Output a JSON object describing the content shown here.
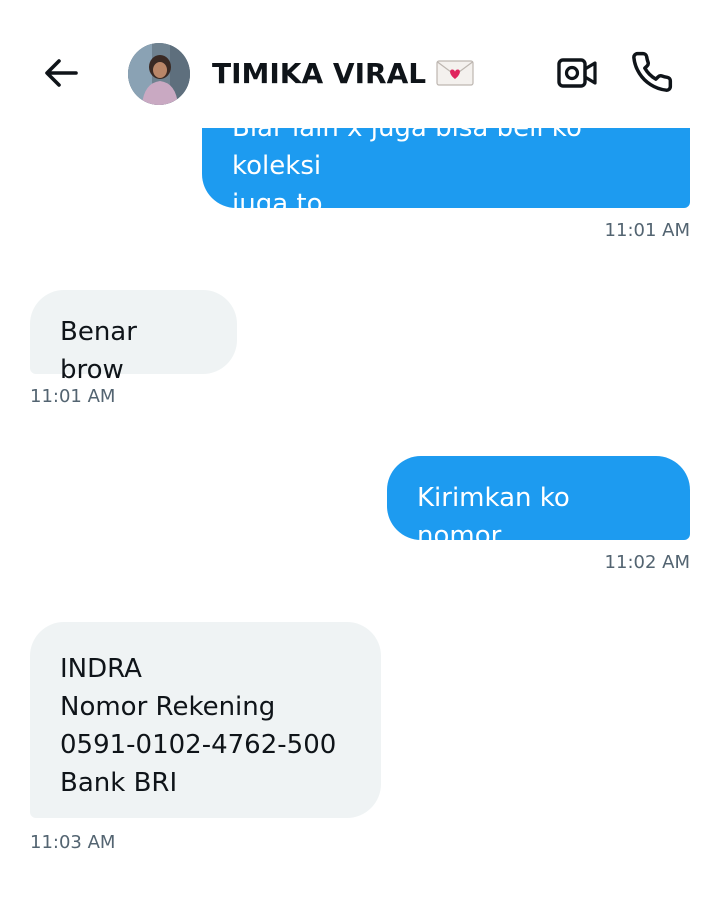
{
  "header": {
    "contact_name": "TIMIKA VIRAL",
    "badge_icon": "love-letter-icon",
    "back_icon": "arrow-left-icon",
    "video_icon": "video-camera-icon",
    "call_icon": "phone-icon"
  },
  "colors": {
    "outgoing_bubble": "#1d9bf0",
    "incoming_bubble": "#eff3f4",
    "timestamp": "#536471"
  },
  "messages": [
    {
      "direction": "out",
      "text": "Biar lain x juga bisa beli ko koleksi\njuga to",
      "time": "11:01 AM"
    },
    {
      "direction": "in",
      "text": "Benar brow",
      "time": "11:01 AM"
    },
    {
      "direction": "out",
      "text": "Kirimkan ko nomor",
      "time": "11:02 AM"
    },
    {
      "direction": "in",
      "text": "INDRA\nNomor Rekening\n0591-0102-4762-500\nBank BRI",
      "time": "11:03 AM"
    }
  ]
}
